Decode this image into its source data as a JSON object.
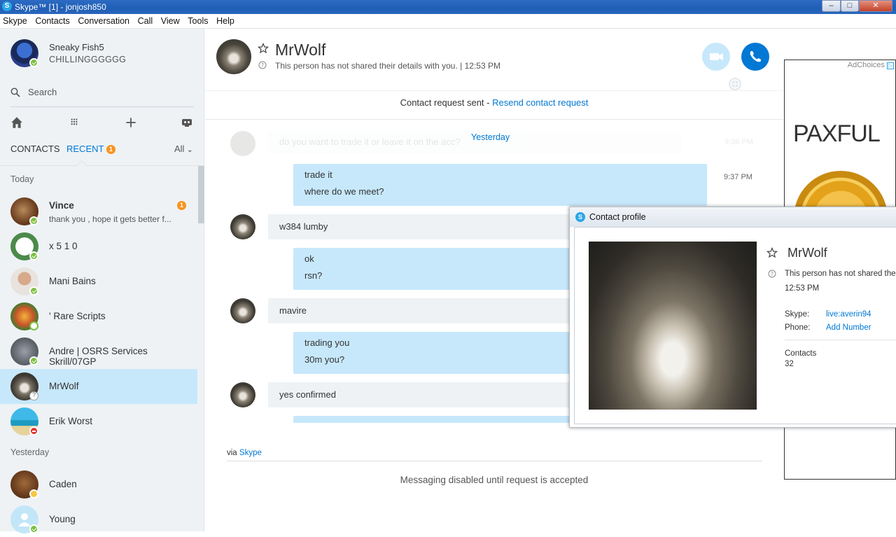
{
  "window": {
    "title": "Skype™ [1] - jonjosh850",
    "logo_letter": "S"
  },
  "menu": [
    "Skype",
    "Contacts",
    "Conversation",
    "Call",
    "View",
    "Tools",
    "Help"
  ],
  "me": {
    "name": "Sneaky Fish5",
    "mood": "CHILLINGGGGGG"
  },
  "search": {
    "placeholder": "Search"
  },
  "tabs": {
    "contacts": "CONTACTS",
    "recent": "RECENT",
    "recent_badge": "1",
    "filter": "All"
  },
  "groups": {
    "today": "Today",
    "yesterday": "Yesterday"
  },
  "contacts": [
    {
      "name": "Vince",
      "preview": "thank you , hope it gets better f...",
      "badge": "1"
    },
    {
      "name": "x 5 1 0"
    },
    {
      "name": "Mani Bains"
    },
    {
      "name": "' Rare Scripts"
    },
    {
      "name": "Andre | OSRS Services Skrill/07GP"
    },
    {
      "name": "MrWolf"
    },
    {
      "name": "Erik Worst"
    },
    {
      "name": "Caden"
    },
    {
      "name": "Young"
    }
  ],
  "conversation": {
    "name": "MrWolf",
    "subtitle": "This person has not shared their details with you.  |  12:53 PM",
    "request_text": "Contact request sent - ",
    "request_link": "Resend contact request",
    "faded_message": "do you want to trade it or leave it on the acc?",
    "faded_time": "9:36 PM",
    "day_divider": "Yesterday",
    "messages": [
      {
        "text1": "trade it",
        "text2": "where do we meet?",
        "time": "9:37 PM"
      },
      {
        "text1": "w384 lumby"
      },
      {
        "text1": "ok",
        "text2": "rsn?"
      },
      {
        "text1": "mavire"
      },
      {
        "text1": "trading you",
        "text2": "30m you?"
      },
      {
        "text1": "yes confirmed"
      }
    ],
    "via_text": "via ",
    "via_link": "Skype",
    "disabled_text": "Messaging disabled until request is accepted"
  },
  "ad": {
    "choices": "AdChoices",
    "brand": "PAXFUL"
  },
  "profile_popup": {
    "title": "Contact profile",
    "name": "MrWolf",
    "details": "This person has not shared their details with you.",
    "time": "12:53 PM",
    "skype_label": "Skype:",
    "skype_value": "live:averin94",
    "phone_label": "Phone:",
    "phone_value": "Add Number",
    "contacts_label": "Contacts",
    "contacts_value": "32"
  },
  "colors": {
    "accent": "#0078d4",
    "selected": "#c7e8fb",
    "badge": "#f7941d",
    "online": "#7bbf3f"
  }
}
